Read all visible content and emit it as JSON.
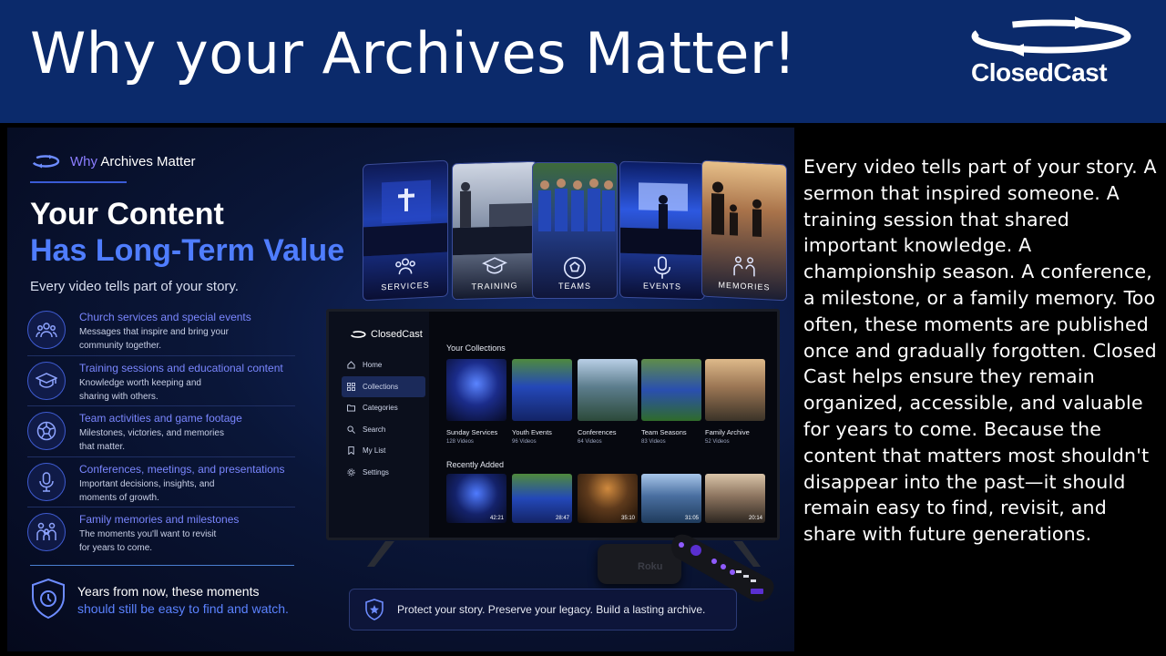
{
  "header": {
    "title": "Why your Archives Matter!",
    "logo_text": "ClosedCast"
  },
  "promo": {
    "kicker_part1": "Why",
    "kicker_part2": "Archives Matter",
    "title_line1": "Your Content",
    "title_line2": "Has Long-Term Value",
    "lead": "Every video tells part of your story.",
    "features": [
      {
        "icon": "people-icon",
        "title": "Church services and special events",
        "desc": "Messages that inspire and bring your\ncommunity together."
      },
      {
        "icon": "graduation-cap-icon",
        "title": "Training sessions and educational content",
        "desc": "Knowledge worth keeping and\nsharing with others."
      },
      {
        "icon": "soccer-ball-icon",
        "title": "Team activities and game footage",
        "desc": "Milestones, victories, and memories\nthat matter."
      },
      {
        "icon": "microphone-icon",
        "title": "Conferences, meetings, and presentations",
        "desc": "Important decisions, insights, and\nmoments of growth."
      },
      {
        "icon": "family-icon",
        "title": "Family memories and milestones",
        "desc": "The moments you'll want to revisit\nfor years to come."
      }
    ],
    "footer_line1": "Years from now, these moments",
    "footer_line2": "should still be easy to find and watch.",
    "tiles": [
      "SERVICES",
      "TRAINING",
      "TEAMS",
      "EVENTS",
      "MEMORIES"
    ],
    "banner": "Protect your story. Preserve your legacy. Build a lasting archive."
  },
  "tv": {
    "logo": "ClosedCast",
    "nav": [
      "Home",
      "Collections",
      "Categories",
      "Search",
      "My List",
      "Settings"
    ],
    "active_nav": "Collections",
    "collections_title": "Your Collections",
    "collections": [
      {
        "label": "Sunday Services",
        "count": "128 Videos"
      },
      {
        "label": "Youth Events",
        "count": "96 Videos"
      },
      {
        "label": "Conferences",
        "count": "64 Videos"
      },
      {
        "label": "Team Seasons",
        "count": "83 Videos"
      },
      {
        "label": "Family Archive",
        "count": "52 Videos"
      }
    ],
    "recent_title": "Recently Added",
    "recent_durations": [
      "42:21",
      "28:47",
      "35:10",
      "31:05",
      "20:14"
    ],
    "remote_brand": "Roku"
  },
  "body_text": "Every video tells part of your story. A sermon that inspired someone. A training session that shared important knowledge. A championship season. A conference, a milestone, or a family memory. Too often, these moments are published once and gradually forgotten. Closed Cast helps ensure they remain organized, accessible, and valuable for years to come. Because the content that matters most shouldn't disappear into the past—it should remain easy to find, revisit, and share with future generations.",
  "colors": {
    "header_bg": "#0b2a6b",
    "accent_blue": "#4f7dff",
    "accent_purple": "#7a86ff"
  }
}
